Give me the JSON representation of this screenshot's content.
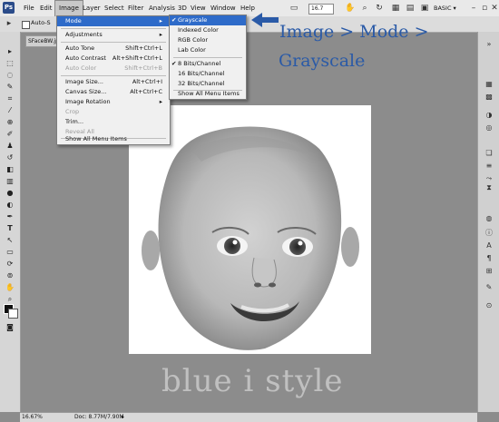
{
  "app": {
    "logo": "Ps"
  },
  "menubar": {
    "items": [
      "File",
      "Edit",
      "Image",
      "Layer",
      "Select",
      "Filter",
      "Analysis",
      "3D",
      "View",
      "Window",
      "Help"
    ],
    "zoom": "16.7",
    "workspace": "BASIC ▾"
  },
  "options_bar": {
    "auto_label": "Auto-S"
  },
  "document": {
    "tab_title": "SFaceBW.jp",
    "zoom_status": "16.67%",
    "doc_info": "Doc: 8.77M/7.90M"
  },
  "image_menu": {
    "items": [
      {
        "label": "Mode",
        "submenu": true,
        "highlighted": true
      },
      {
        "label": "Adjustments",
        "submenu": true
      },
      {
        "label": "Auto Tone",
        "shortcut": "Shift+Ctrl+L"
      },
      {
        "label": "Auto Contrast",
        "shortcut": "Alt+Shift+Ctrl+L"
      },
      {
        "label": "Auto Color",
        "shortcut": "Shift+Ctrl+B",
        "disabled": true
      },
      {
        "label": "Image Size...",
        "shortcut": "Alt+Ctrl+I"
      },
      {
        "label": "Canvas Size...",
        "shortcut": "Alt+Ctrl+C"
      },
      {
        "label": "Image Rotation",
        "submenu": true
      },
      {
        "label": "Crop",
        "disabled": true
      },
      {
        "label": "Trim..."
      },
      {
        "label": "Reveal All",
        "disabled": true
      },
      {
        "label": "Show All Menu Items"
      }
    ]
  },
  "mode_menu": {
    "items": [
      {
        "label": "Grayscale",
        "checked": true,
        "highlighted": true
      },
      {
        "label": "Indexed Color"
      },
      {
        "label": "RGB Color"
      },
      {
        "label": "Lab Color"
      },
      {
        "label": "8 Bits/Channel",
        "checked": true
      },
      {
        "label": "16 Bits/Channel"
      },
      {
        "label": "32 Bits/Channel"
      },
      {
        "label": "Show All Menu Items"
      }
    ]
  },
  "annotation": {
    "line1": "Image > Mode >",
    "line2": "Grayscale",
    "arrow": "left-arrow-icon"
  },
  "watermark": "blue i style",
  "colors": {
    "highlight": "#2e6bc9",
    "annotation": "#2a5aa7"
  }
}
